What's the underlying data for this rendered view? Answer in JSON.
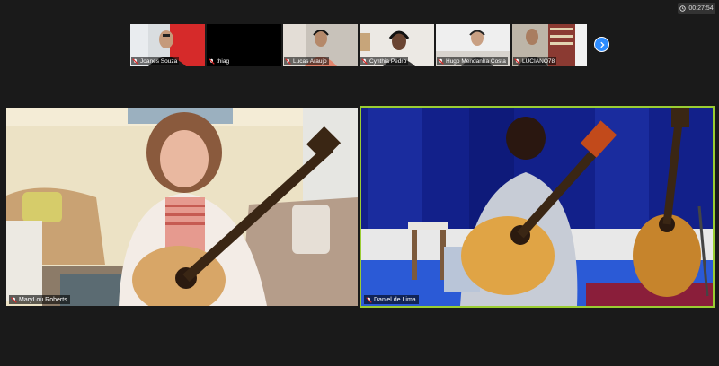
{
  "meeting": {
    "timer": "00:27:54"
  },
  "gallery_strip": {
    "participants": [
      {
        "name": "Joanes Souza",
        "muted": true
      },
      {
        "name": "thiag",
        "muted": true
      },
      {
        "name": "Lucas Araujo",
        "muted": true
      },
      {
        "name": "Cynthia Pedro",
        "muted": true
      },
      {
        "name": "Hugo Mendanha Costa",
        "muted": true
      },
      {
        "name": "LUCIANO78",
        "muted": true
      }
    ],
    "next_icon": "chevron-right-icon"
  },
  "main_videos": [
    {
      "name": "MaryLou Roberts",
      "muted": true
    },
    {
      "name": "Daniel de Lima",
      "muted": true,
      "active_speaker": true
    }
  ],
  "colors": {
    "active_speaker_border": "#9acd32",
    "accent": "#2d8cff"
  }
}
